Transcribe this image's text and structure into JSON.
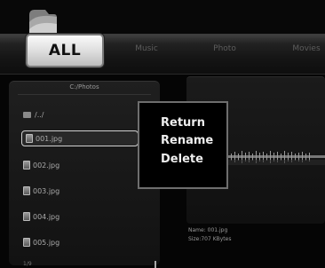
{
  "tabs": {
    "all": "ALL",
    "music": "Music",
    "photo": "Photo",
    "movies": "Movies"
  },
  "browser": {
    "path": "C:/Photos",
    "parent": "/../",
    "files": [
      "001.jpg",
      "002.jpg",
      "003.jpg",
      "004.jpg",
      "005.jpg"
    ],
    "selected_index": 0,
    "footer": "1/9"
  },
  "context_menu": {
    "items": [
      "Return",
      "Rename",
      "Delete"
    ]
  },
  "preview": {
    "name": "Name: 001.jpg",
    "size": "Size:707 KBytes"
  }
}
